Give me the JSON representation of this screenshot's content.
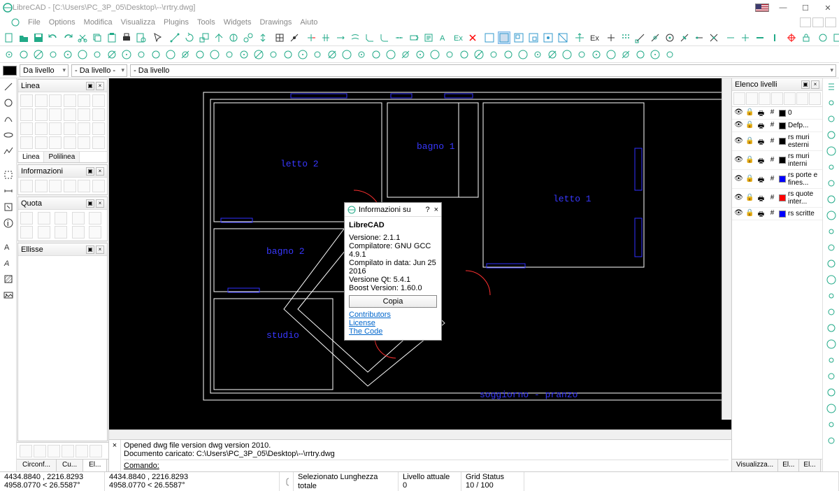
{
  "titlebar": {
    "text": "LibreCAD - [C:\\Users\\PC_3P_05\\Desktop\\--\\rrtry.dwg]"
  },
  "menu": [
    "File",
    "Options",
    "Modifica",
    "Visualizza",
    "Plugins",
    "Tools",
    "Widgets",
    "Drawings",
    "Aiuto"
  ],
  "props": {
    "bylayer_1": "Da livello",
    "bylayer_2": "- Da livello -",
    "bylayer_3": "- Da livello"
  },
  "panels": {
    "linea": {
      "title": "Linea",
      "tabs": [
        "Linea",
        "Polilinea"
      ]
    },
    "info": "Informazioni",
    "quota": "Quota",
    "ellisse": "Ellisse"
  },
  "layers_panel": {
    "title": "Elenco livelli",
    "items": [
      {
        "name": "0",
        "color": "#000000"
      },
      {
        "name": "Defp...",
        "color": "#000000"
      },
      {
        "name": "rs muri esterni",
        "color": "#000000"
      },
      {
        "name": "rs muri interni",
        "color": "#000000"
      },
      {
        "name": "rs porte e fines...",
        "color": "#0000ff"
      },
      {
        "name": "rs quote inter...",
        "color": "#ff0000"
      },
      {
        "name": "rs scritte",
        "color": "#0000ff"
      }
    ]
  },
  "rooms": {
    "letto2": "letto 2",
    "bagno1": "bagno 1",
    "letto1": "letto 1",
    "bagno2": "bagno 2",
    "studio": "studio",
    "soggiorno": "soggiorno - pranzo"
  },
  "dialog": {
    "title": "Informazioni su",
    "app": "LibreCAD",
    "version_lbl": "Versione:",
    "version": "2.1.1",
    "compiler_lbl": "Compilatore:",
    "compiler": "GNU GCC 4.9.1",
    "date_lbl": "Compilato in data:",
    "date": "Jun 25 2016",
    "qt_lbl": "Versione Qt:",
    "qt": "5.4.1",
    "boost_lbl": "Boost Version:",
    "boost": "1.60.0",
    "copy": "Copia",
    "links": [
      "Contributors",
      "License",
      "The Code"
    ]
  },
  "cmd": {
    "line1": "Opened dwg file version dwg version 2010.",
    "line2": "Documento caricato: C:\\Users\\PC_3P_05\\Desktop\\--\\rrtry.dwg",
    "prompt": "Comando:"
  },
  "bottom_tabs": [
    "Circonf...",
    "Cu...",
    "El..."
  ],
  "right_tabs": [
    "Visualizza...",
    "El...",
    "El..."
  ],
  "status": {
    "coords_a": "4434.8840 , 2216.8293",
    "coords_b": "4958.0770 < 26.5587°",
    "coords_a2": "4434.8840 , 2216.8293",
    "coords_b2": "4958.0770 < 26.5587°",
    "sel": "Selezionato Lunghezza totale",
    "layer_lbl": "Livello attuale",
    "layer_val": "0",
    "grid_lbl": "Grid Status",
    "grid_val": "10 / 100"
  }
}
